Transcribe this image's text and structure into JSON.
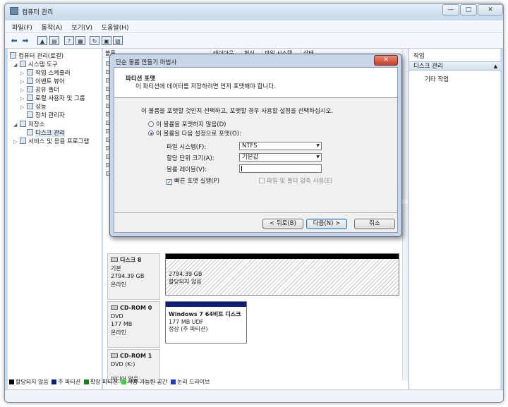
{
  "window": {
    "title": "컴퓨터 관리",
    "caption_buttons": {
      "minimize": "—",
      "maximize": "▢",
      "close": "✕"
    }
  },
  "menu": [
    "파일(F)",
    "동작(A)",
    "보기(V)",
    "도움말(H)"
  ],
  "toolbar": {
    "icons": [
      "back-arrow-icon",
      "forward-arrow-icon",
      "up-folder-icon",
      "show-hide-tree-icon",
      "help-icon",
      "console-icon",
      "refresh-icon",
      "properties-icon",
      "export-icon"
    ]
  },
  "tree": {
    "root": "컴퓨터 관리(로컬)",
    "system_tools": "시스템 도구",
    "task_scheduler": "작업 스케줄러",
    "event_viewer": "이벤트 뷰어",
    "shared_folders": "공유 폴더",
    "local_users": "로컬 사용자 및 그룹",
    "performance": "성능",
    "device_manager": "장치 관리자",
    "storage": "저장소",
    "disk_management": "디스크 관리",
    "services_apps": "서비스 및 응용 프로그램"
  },
  "volume_list": {
    "headers": [
      "볼륨",
      "레이아웃",
      "형식",
      "파일 시스템",
      "상태"
    ]
  },
  "disks": [
    {
      "name": "디스크 8",
      "type": "기본",
      "size": "2794.39 GB",
      "status": "온라인",
      "partition_size": "2794.39 GB",
      "partition_status": "할당되지 않음"
    },
    {
      "name": "CD-ROM 0",
      "type": "DVD",
      "size": "177 MB",
      "status": "온라인",
      "partition_name": "Windows 7 64비트 디스크",
      "partition_detail": "177 MB UDF",
      "partition_status": "정상 (주 파티션)"
    },
    {
      "name": "CD-ROM 1",
      "type": "DVD (K:)",
      "status": "미디어 없음"
    }
  ],
  "legend": [
    {
      "label": "할당되지 않음",
      "color": "#000000"
    },
    {
      "label": "주 파티션",
      "color": "#0a1e7a"
    },
    {
      "label": "확장 파티션",
      "color": "#1b7d1b"
    },
    {
      "label": "사용 가능한 공간",
      "color": "#39d139"
    },
    {
      "label": "논리 드라이브",
      "color": "#1f3cc8"
    }
  ],
  "actions": {
    "header": "작업",
    "section": "디스크 관리",
    "more": "기타 작업"
  },
  "wizard": {
    "title": "단순 볼륨 만들기 마법사",
    "heading": "파티션 포맷",
    "subheading": "이 파티션에 데이터를 저장하려면 먼저 포맷해야 합니다.",
    "prompt": "이 볼륨을 포맷할 것인지 선택하고, 포맷할 경우 사용할 설정을 선택하십시오.",
    "radio_no_format": "이 볼륨을 포맷하지 않음(D)",
    "radio_format": "이 볼륨을 다음 설정으로 포맷(O):",
    "fs_label": "파일 시스템(F):",
    "fs_value": "NTFS",
    "alloc_label": "할당 단위 크기(A):",
    "alloc_value": "기본값",
    "volume_label_label": "볼륨 레이블(V):",
    "volume_label_value": "",
    "quick_format": "빠른 포맷 실행(P)",
    "compression": "파일 및 폴더 압축 사용(E)",
    "back_button": "< 뒤로(B)",
    "next_button": "다음(N) >",
    "cancel_button": "취소"
  }
}
